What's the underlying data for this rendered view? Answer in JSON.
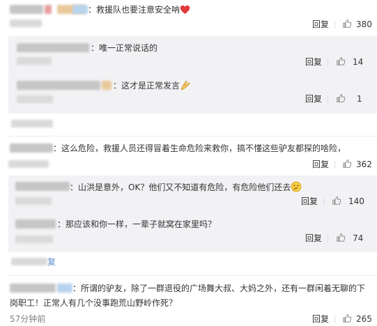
{
  "comments": [
    {
      "text": "：救援队也要注意安全呐",
      "emoji": "heart",
      "reply_label": "回复",
      "likes": "380",
      "replies": [
        {
          "text": "：唯一正常说话的",
          "reply_label": "回复",
          "likes": "14"
        },
        {
          "text": "：这才是正常发言",
          "emoji": "pray-hands",
          "reply_label": "回复",
          "likes": "1"
        }
      ]
    },
    {
      "text": "：这么危险，救援人员还得冒着生命危险来救你，搞不懂这些驴友都探的啥险，",
      "reply_label": "回复",
      "likes": "362",
      "replies": [
        {
          "text": "：山洪是意外，OK？他们又不知道有危险，有危险他们还去",
          "emoji": "thinking-face",
          "reply_label": "回复",
          "likes": "140"
        },
        {
          "text": "：那应该和你一样，一辈子就窝在家里吗？",
          "reply_label": "回复",
          "likes": "74"
        }
      ],
      "more_link": "复"
    },
    {
      "text_line1": "：所谓的驴友，除了一群退役的广场舞大叔、大妈之外，还有一群闲着无聊的下",
      "text_line2": "岗职工！正常人有几个没事跑荒山野岭作死？",
      "time": "57分钟前",
      "reply_label": "回复",
      "likes": "265"
    }
  ],
  "colors": {
    "reply_bg": "#f2f2f5",
    "link": "#5d8fcf",
    "meta": "#808080",
    "text": "#333333"
  },
  "icons": {
    "like": "thumbs-up-icon",
    "heart": "heart-emoji-icon",
    "pray": "pray-hands-emoji-icon",
    "thinking": "thinking-face-emoji-icon"
  }
}
